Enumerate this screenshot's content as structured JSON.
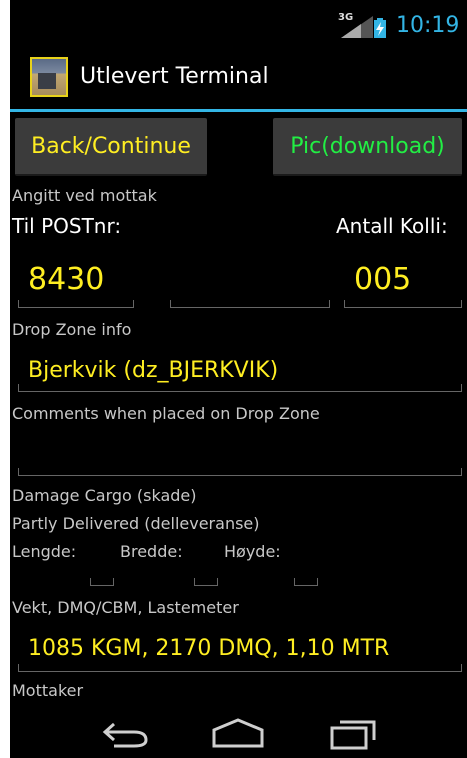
{
  "status": {
    "network": "3G",
    "time": "10:19"
  },
  "actionbar": {
    "title": "Utlevert Terminal"
  },
  "buttons": {
    "back": "Back/Continue",
    "pic": "Pic(download)"
  },
  "form": {
    "received_label": "Angitt ved mottak",
    "postnr_label": "Til POSTnr:",
    "kolli_label": "Antall Kolli:",
    "postnr_value": "8430",
    "kolli_value": "005",
    "dropzone_label": "Drop Zone info",
    "dropzone_value": "Bjerkvik (dz_BJERKVIK)",
    "comments_label": "Comments when placed on Drop Zone",
    "comments_value": "",
    "damage_label": "Damage Cargo (skade)",
    "partly_label": "Partly Delivered (delleveranse)",
    "lengde_label": "Lengde:",
    "bredde_label": "Bredde:",
    "hoyde_label": "Høyde:",
    "weight_label": "Vekt, DMQ/CBM, Lastemeter",
    "weight_value": "1085 KGM, 2170 DMQ, 1,10 MTR",
    "mottaker_label": "Mottaker"
  },
  "navbar": {
    "back": "back-icon",
    "home": "home-icon",
    "recents": "recents-icon"
  },
  "colors": {
    "accent": "#33b5e5",
    "value": "#ffee22",
    "pic_button": "#22ee44"
  }
}
